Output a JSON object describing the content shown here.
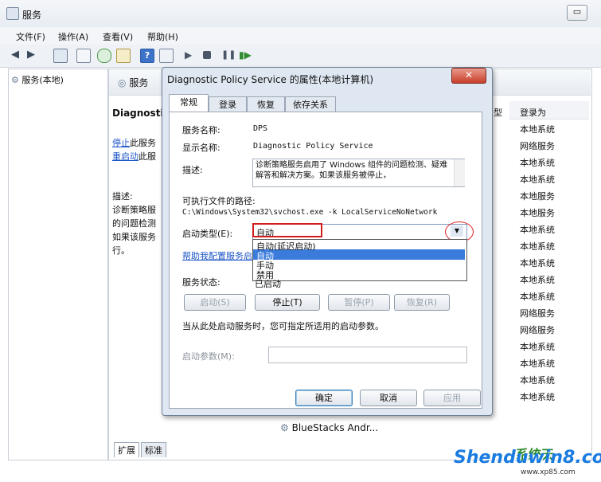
{
  "window": {
    "title": "服务",
    "min_glyph": "▭"
  },
  "menu": [
    "文件(F)",
    "操作(A)",
    "查看(V)",
    "帮助(H)"
  ],
  "left_pane": {
    "item": "服务(本地)"
  },
  "right_pane": {
    "header": "服务",
    "service_title": "Diagnosti",
    "stop_link": "停止",
    "stop_rest": "此服务",
    "restart_link": "重启动",
    "restart_rest": "此服",
    "desc_label": "描述:",
    "desc_lines": [
      "诊断策略服",
      "的问题检测",
      "如果该服务",
      "行。"
    ],
    "col_header_fragment": "型",
    "col_logon": "登录为",
    "logon_values": [
      "本地系统",
      "网络服务",
      "本地系统",
      "本地系统",
      "本地服务",
      "本地服务",
      "本地系统",
      "本地系统",
      "本地系统",
      "本地系统",
      "本地系统",
      "网络服务",
      "网络服务",
      "本地系统",
      "本地系统",
      "本地系统",
      "本地系统"
    ],
    "bluestacks": "BlueStacks Andr...",
    "bottom_tabs": [
      "扩展",
      "标准"
    ]
  },
  "watermark": {
    "main": "Shenduwin8.com",
    "sub": "www.xp85.com",
    "fragment": "系统天"
  },
  "dialog": {
    "title": "Diagnostic Policy Service 的属性(本地计算机)",
    "close": "✕",
    "tabs": [
      "常规",
      "登录",
      "恢复",
      "依存关系"
    ],
    "service_name_label": "服务名称:",
    "service_name": "DPS",
    "display_name_label": "显示名称:",
    "display_name": "Diagnostic Policy Service",
    "desc_label": "描述:",
    "description": "诊断策略服务启用了 Windows 组件的问题检测、疑难解答和解决方案。如果该服务被停止，",
    "path_label": "可执行文件的路径:",
    "path": "C:\\Windows\\System32\\svchost.exe -k LocalServiceNoNetwork",
    "startup_label": "启动类型(E):",
    "startup_value": "自动",
    "startup_options": [
      "自动(延迟启动)",
      "自动",
      "手动",
      "禁用"
    ],
    "help_link": "帮助我配置服务启",
    "status_label": "服务状态:",
    "status_value": "已启动",
    "buttons": {
      "start": "启动(S)",
      "stop": "停止(T)",
      "pause": "暂停(P)",
      "resume": "恢复(R)"
    },
    "hint": "当从此处启动服务时，您可指定所适用的启动参数。",
    "params_label": "启动参数(M):",
    "ok": "确定",
    "cancel": "取消",
    "apply": "应用"
  }
}
